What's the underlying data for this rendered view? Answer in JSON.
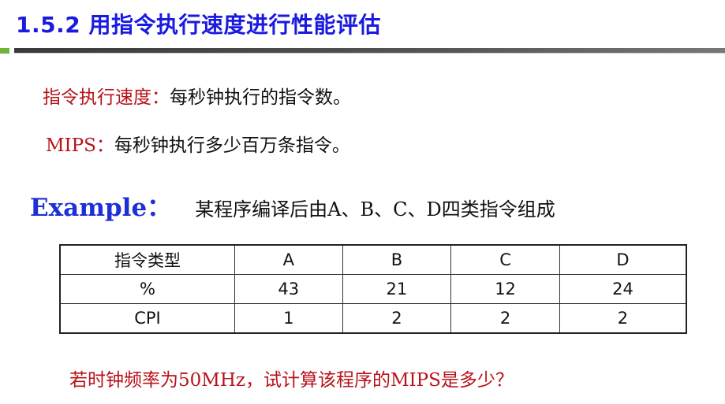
{
  "slide": {
    "title": "1.5.2  用指令执行速度进行性能评估",
    "definitions": [
      {
        "term": "指令执行速度：",
        "description": "每秒钟执行的指令数。"
      },
      {
        "term": "MIPS：",
        "description": "每秒钟执行多少百万条指令。"
      }
    ],
    "example": {
      "label": "Example：",
      "text": "某程序编译后由A、B、C、D四类指令组成"
    },
    "table": {
      "headers": [
        "指令类型",
        "A",
        "B",
        "C",
        "D"
      ],
      "rows": [
        [
          "%",
          "43",
          "21",
          "12",
          "24"
        ],
        [
          "CPI",
          "1",
          "2",
          "2",
          "2"
        ]
      ]
    },
    "question": "若时钟频率为50MHz，试计算该程序的MIPS是多少？"
  },
  "colors": {
    "title": "#1a1ae0",
    "term": "#b8121a",
    "example_label": "#1d2fd6",
    "question": "#b8121a",
    "accent_green": "#6fb53a"
  }
}
